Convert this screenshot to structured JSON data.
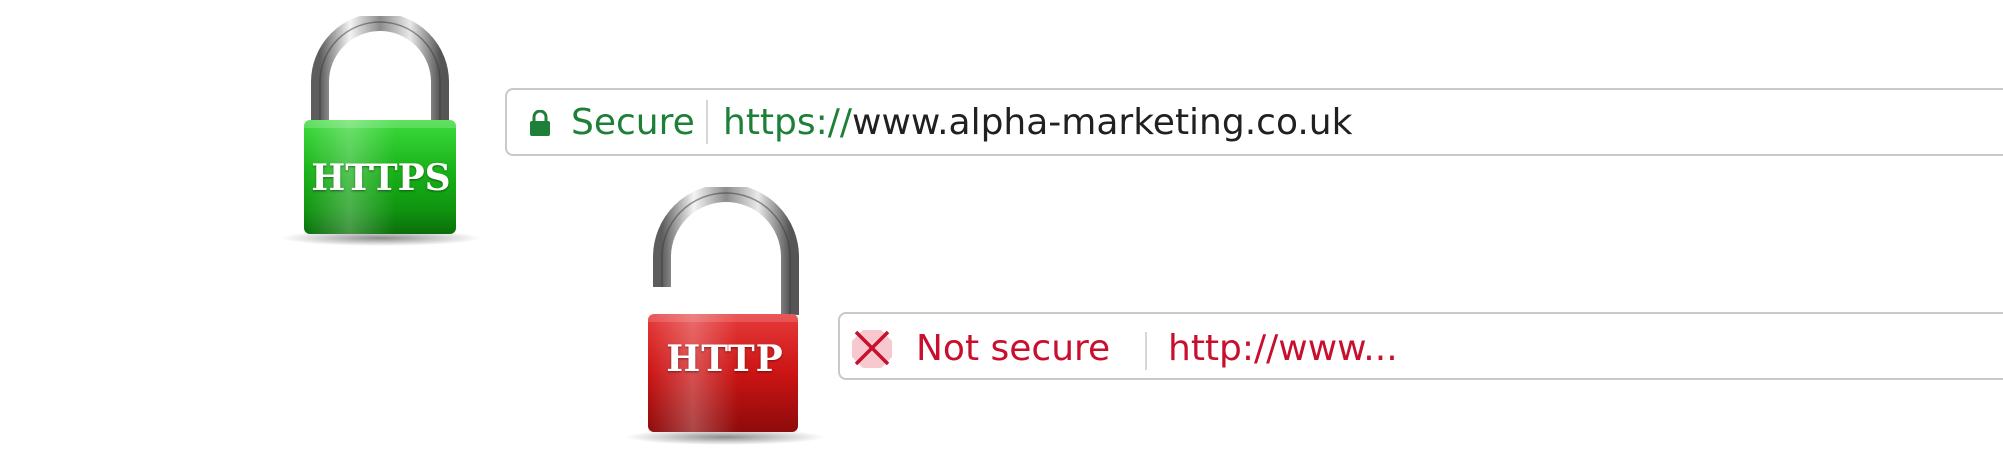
{
  "padlocks": {
    "https": {
      "label": "HTTPS",
      "icon": "locked-padlock-icon",
      "color": "#1fbf1f",
      "state": "closed"
    },
    "http": {
      "label": "HTTP",
      "icon": "unlocked-padlock-icon",
      "color": "#d4141b",
      "state": "open"
    }
  },
  "secure_bar": {
    "icon": "lock-icon",
    "status_label": "Secure",
    "url_scheme": "https://",
    "url_host": "www.alpha-marketing.co.uk",
    "accent_color": "#1e8038"
  },
  "insecure_bar": {
    "icon": "not-secure-x-icon",
    "status_label": "Not secure",
    "url": "http://www...",
    "accent_color": "#c8102e"
  }
}
